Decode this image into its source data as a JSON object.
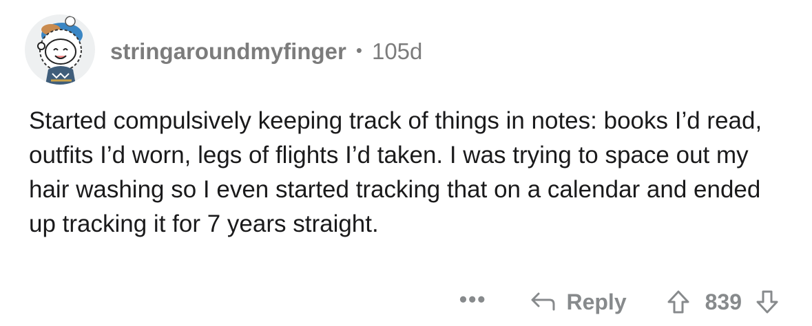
{
  "comment": {
    "username": "stringaroundmyfinger",
    "separator": "•",
    "age": "105d",
    "body": "Started compulsively keeping track of things in notes: books I’d read, outfits I’d worn, legs of flights I’d taken. I was trying to space out my hair washing so I even started tracking that on a calendar and ended up tracking it for 7 years straight."
  },
  "actions": {
    "more": "•••",
    "reply_label": "Reply",
    "score": "839"
  },
  "icons": {
    "avatar": "snoo-avatar-icon",
    "reply": "reply-arrow-icon",
    "upvote": "upvote-arrow-icon",
    "downvote": "downvote-arrow-icon"
  },
  "colors": {
    "meta_text": "#7c7c7c",
    "body_text": "#1a1a1b",
    "action_text": "#878a8c",
    "avatar_bg": "#eef0f1"
  }
}
